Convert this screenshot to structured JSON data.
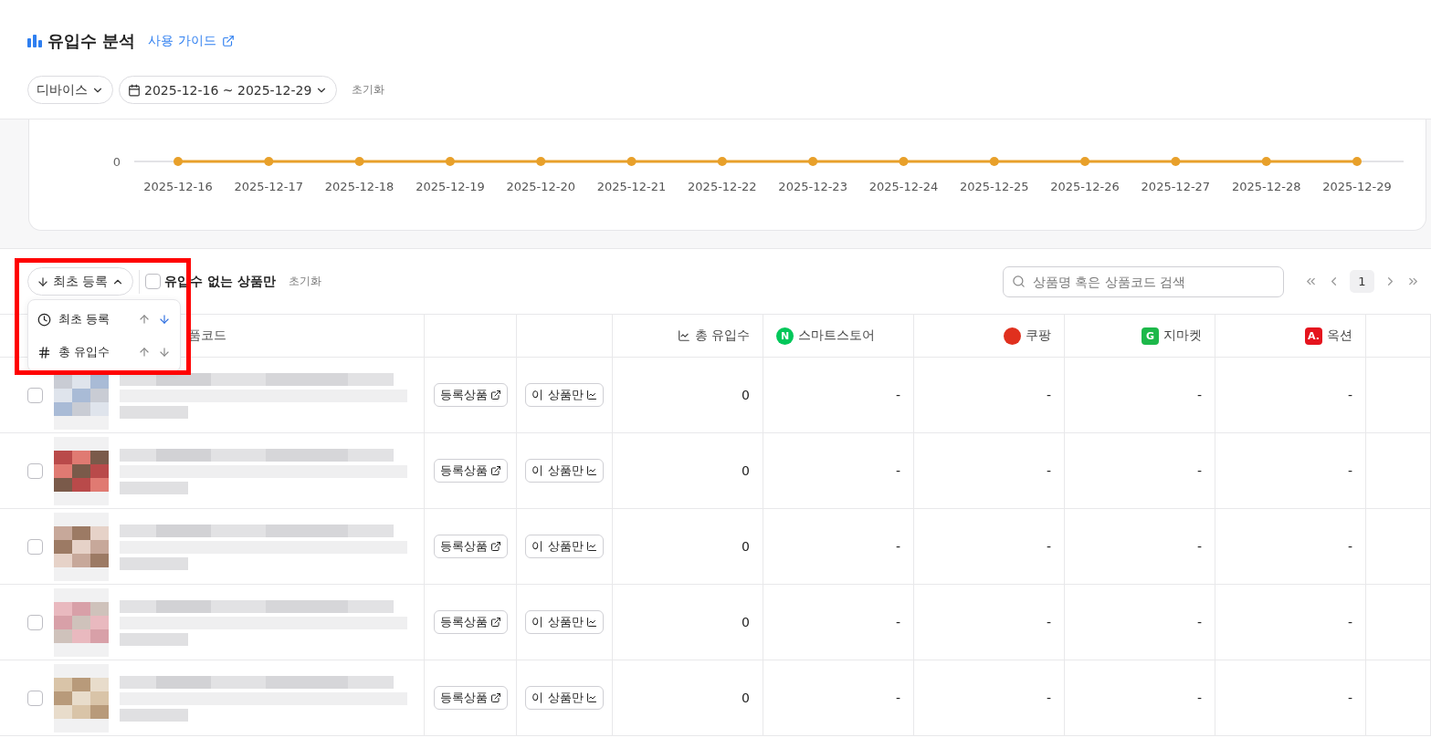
{
  "header": {
    "title": "유입수 분석",
    "guide_link": "사용 가이드"
  },
  "filters": {
    "device": "디바이스",
    "date_range": "2025-12-16 ~ 2025-12-29",
    "reset": "초기화"
  },
  "chart": {
    "y_tick": "0",
    "x_labels": [
      "2025-12-16",
      "2025-12-17",
      "2025-12-18",
      "2025-12-19",
      "2025-12-20",
      "2025-12-21",
      "2025-12-22",
      "2025-12-23",
      "2025-12-24",
      "2025-12-25",
      "2025-12-26",
      "2025-12-27",
      "2025-12-28",
      "2025-12-29"
    ]
  },
  "toolbar": {
    "sort_button": "최초 등록",
    "sort_menu_open": true,
    "no_traffic_only": {
      "label": "유입수 없는 상품만",
      "checked": false
    },
    "reset": "초기화",
    "search": {
      "placeholder": "상품명 혹은 상품코드 검색"
    },
    "pages": [
      {
        "label": "1",
        "selected": true
      }
    ]
  },
  "sort_menu": {
    "options": [
      {
        "label": "최초 등록",
        "kind": "clock",
        "asc_selected": false,
        "desc_selected": true
      },
      {
        "label": "총 유입수",
        "kind": "hash",
        "asc_selected": false,
        "desc_selected": false
      }
    ]
  },
  "table": {
    "columns": {
      "product": "품코드",
      "total": "총 유입수",
      "channels": [
        {
          "name": "스마트스토어",
          "badge": "N",
          "color": "#03c75a",
          "kind": "circle"
        },
        {
          "name": "쿠팡",
          "color": "#e0301e",
          "kind": "circle"
        },
        {
          "name": "지마켓",
          "badge": "G",
          "color": "#1db84a",
          "kind": "square"
        },
        {
          "name": "옥션",
          "badge": "A.",
          "color": "#e5141e",
          "kind": "square"
        }
      ]
    },
    "rows": [
      {
        "checked": false,
        "register_button": "등록상품",
        "only_button": "이 상품만",
        "total": "0",
        "channels": [
          "-",
          "-",
          "-",
          "-"
        ]
      },
      {
        "checked": false,
        "register_button": "등록상품",
        "only_button": "이 상품만",
        "total": "0",
        "channels": [
          "-",
          "-",
          "-",
          "-"
        ]
      },
      {
        "checked": false,
        "register_button": "등록상품",
        "only_button": "이 상품만",
        "total": "0",
        "channels": [
          "-",
          "-",
          "-",
          "-"
        ]
      },
      {
        "checked": false,
        "register_button": "등록상품",
        "only_button": "이 상품만",
        "total": "0",
        "channels": [
          "-",
          "-",
          "-",
          "-"
        ]
      },
      {
        "checked": false,
        "register_button": "등록상품",
        "only_button": "이 상품만",
        "total": "0",
        "channels": [
          "-",
          "-",
          "-",
          "-"
        ]
      }
    ]
  },
  "highlight": {
    "shown": true
  }
}
